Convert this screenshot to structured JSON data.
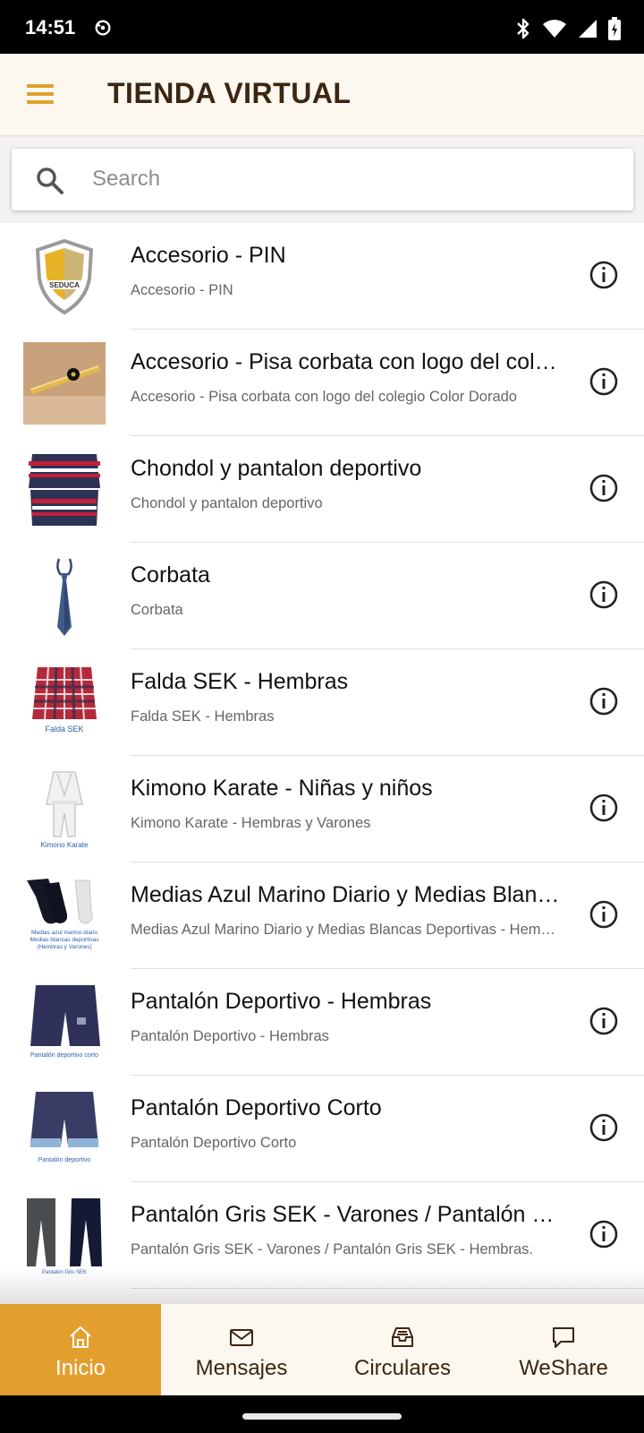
{
  "status_bar": {
    "time": "14:51",
    "icons": [
      "sync-icon",
      "bluetooth-icon",
      "wifi-icon",
      "signal-icon",
      "battery-icon"
    ]
  },
  "app_bar": {
    "title": "TIENDA VIRTUAL",
    "menu_icon": "hamburger-menu-icon",
    "accent_color": "#e0a030",
    "title_color": "#3b2612",
    "background": "#fcf8ef"
  },
  "search": {
    "placeholder": "Search",
    "value": "",
    "icon": "search-icon"
  },
  "products": [
    {
      "title": "Accesorio - PIN",
      "subtitle": "Accesorio - PIN",
      "thumb": "seduca-shield-logo"
    },
    {
      "title": "Accesorio - Pisa corbata con logo del colegio Color Dorado",
      "subtitle": "Accesorio - Pisa corbata con logo del colegio Color Dorado",
      "thumb": "tie-clip-photo"
    },
    {
      "title": "Chondol y pantalon deportivo",
      "subtitle": "Chondol y pantalon deportivo",
      "thumb": "sport-set-photo"
    },
    {
      "title": "Corbata",
      "subtitle": "Corbata",
      "thumb": "tie-photo"
    },
    {
      "title": "Falda SEK - Hembras",
      "subtitle": "Falda SEK - Hembras",
      "thumb": "plaid-skirt-photo",
      "thumb_caption": "Falda SEK"
    },
    {
      "title": "Kimono Karate - Niñas y niños",
      "subtitle": "Kimono Karate - Hembras y Varones",
      "thumb": "kimono-photo",
      "thumb_caption": "Kimono Karate"
    },
    {
      "title": "Medias Azul Marino Diario y Medias Blancas Deportivas",
      "subtitle": "Medias Azul Marino Diario y Medias Blancas Deportivas - Hembras y Varones",
      "thumb": "socks-photo",
      "thumb_caption": "Medias azul marino diario"
    },
    {
      "title": "Pantalón Deportivo - Hembras",
      "subtitle": "Pantalón Deportivo - Hembras",
      "thumb": "sport-shorts-photo",
      "thumb_caption": "Pantalón deportivo corto"
    },
    {
      "title": "Pantalón Deportivo Corto",
      "subtitle": "Pantalón Deportivo Corto",
      "thumb": "sport-shorts-photo",
      "thumb_caption": "Pantalón deportivo"
    },
    {
      "title": "Pantalón Gris SEK - Varones / Pantalón Gris SEK - Hembras.",
      "subtitle": "Pantalón Gris SEK - Varones / Pantalón Gris SEK - Hembras.",
      "thumb": "trousers-photo",
      "thumb_caption": "Pantalón Gris SEK"
    }
  ],
  "bottom_nav": {
    "items": [
      {
        "label": "Inicio",
        "icon": "home-icon",
        "active": true
      },
      {
        "label": "Mensajes",
        "icon": "mail-icon",
        "active": false
      },
      {
        "label": "Circulares",
        "icon": "inbox-tray-icon",
        "active": false
      },
      {
        "label": "WeShare",
        "icon": "chat-bubble-icon",
        "active": false
      }
    ],
    "active_color": "#e39f2e"
  }
}
